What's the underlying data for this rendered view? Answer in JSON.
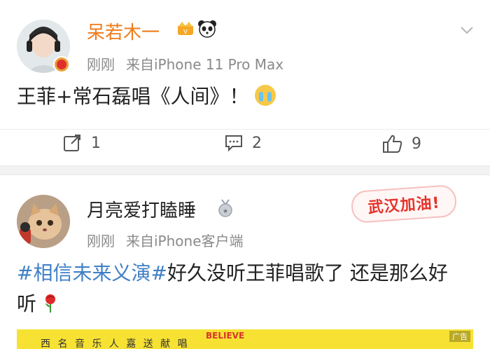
{
  "post1": {
    "username": "呆若木一",
    "time": "刚刚",
    "source": "来自iPhone 11 Pro Max",
    "content": "王菲+常石磊唱《人间》！",
    "repost_count": "1",
    "comment_count": "2",
    "like_count": "9"
  },
  "post2": {
    "username": "月亮爱打瞌睡",
    "time": "刚刚",
    "source": "来自iPhone客户端",
    "topic": "#相信未来义演#",
    "content": "好久没听王菲唱歌了 还是那么好听",
    "sticker_text": "武汉加油!"
  },
  "ad": {
    "tag": "广告",
    "text": "西 名 音 乐 人 嘉 送 献 唱",
    "logo_text": "BELIEVE"
  },
  "colors": {
    "username_vip": "#f07b1a",
    "topic_link": "#3f7fc6",
    "meta_gray": "#8a8a8a",
    "ad_yellow": "#f7e233"
  }
}
